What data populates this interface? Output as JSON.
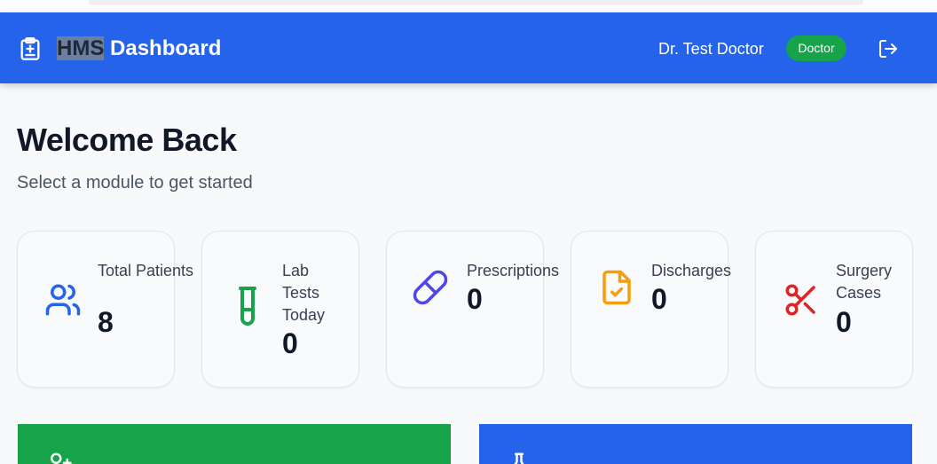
{
  "header": {
    "title_highlight": "HMS",
    "title_rest": " Dashboard",
    "user_name": "Dr. Test Doctor",
    "role": "Doctor",
    "brand_icon": "hospital-clipboard-icon",
    "logout_icon": "logout-icon"
  },
  "welcome": {
    "title": "Welcome Back",
    "subtitle": "Select a module to get started"
  },
  "stats": [
    {
      "label": "Total Patients",
      "value": "8",
      "icon": "users-icon",
      "color": "#2563eb"
    },
    {
      "label": "Lab Tests Today",
      "value": "0",
      "icon": "test-tube-icon",
      "color": "#16a34a"
    },
    {
      "label": "Prescriptions",
      "value": "0",
      "icon": "pill-icon",
      "color": "#4f46e5"
    },
    {
      "label": "Discharges",
      "value": "0",
      "icon": "file-check-icon",
      "color": "#f59e0b"
    },
    {
      "label": "Surgery Cases",
      "value": "0",
      "icon": "scissors-icon",
      "color": "#dc2626"
    }
  ],
  "modules": [
    {
      "icon": "user-plus-icon",
      "color": "#16a34a"
    },
    {
      "icon": "flask-icon",
      "color": "#2563eb"
    }
  ],
  "colors": {
    "primary": "#2563eb",
    "success": "#16a34a",
    "background": "#f8f9fb"
  }
}
